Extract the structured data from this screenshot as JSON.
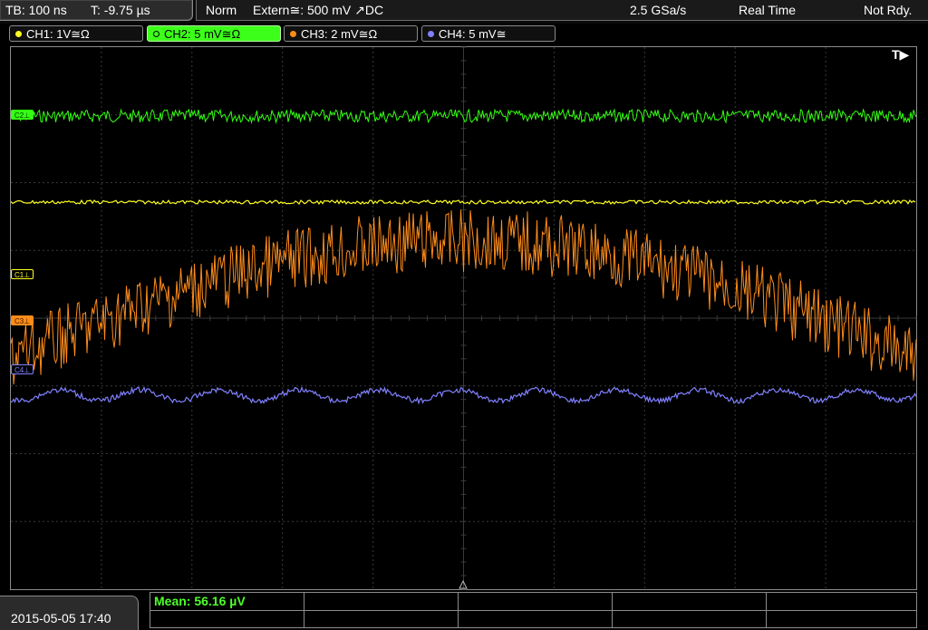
{
  "header": {
    "timebase": "TB: 100 ns",
    "trigger_offset": "T: -9.75 µs",
    "trigger_mode": "Norm",
    "trigger_source": "Extern≅: 500 mV ↗DC",
    "sample_rate": "2.5 GSa/s",
    "acquisition_mode": "Real Time",
    "status": "Not Rdy."
  },
  "channels": [
    {
      "label": "CH1: 1V≅Ω",
      "color": "#ffff22",
      "active": false
    },
    {
      "label": "CH2: 5 mV≅Ω",
      "color": "#33ff11",
      "active": true
    },
    {
      "label": "CH3: 2 mV≅Ω",
      "color": "#ff8c1a",
      "active": false
    },
    {
      "label": "CH4: 5 mV≅",
      "color": "#8080ff",
      "active": false
    }
  ],
  "markers": {
    "ch1": "C1⊥",
    "ch2": "C2⊥",
    "ch3": "C3⊥",
    "ch4": "C4⊥",
    "trigger_position": "T▶"
  },
  "footer": {
    "datetime": "2015-05-05 17:40",
    "measurement": "Mean: 56.16 µV"
  },
  "colors": {
    "ch1": "#ffff22",
    "ch2": "#33ff11",
    "ch3": "#ff8c1a",
    "ch4": "#8080ff",
    "grid": "#3a3a3a"
  }
}
